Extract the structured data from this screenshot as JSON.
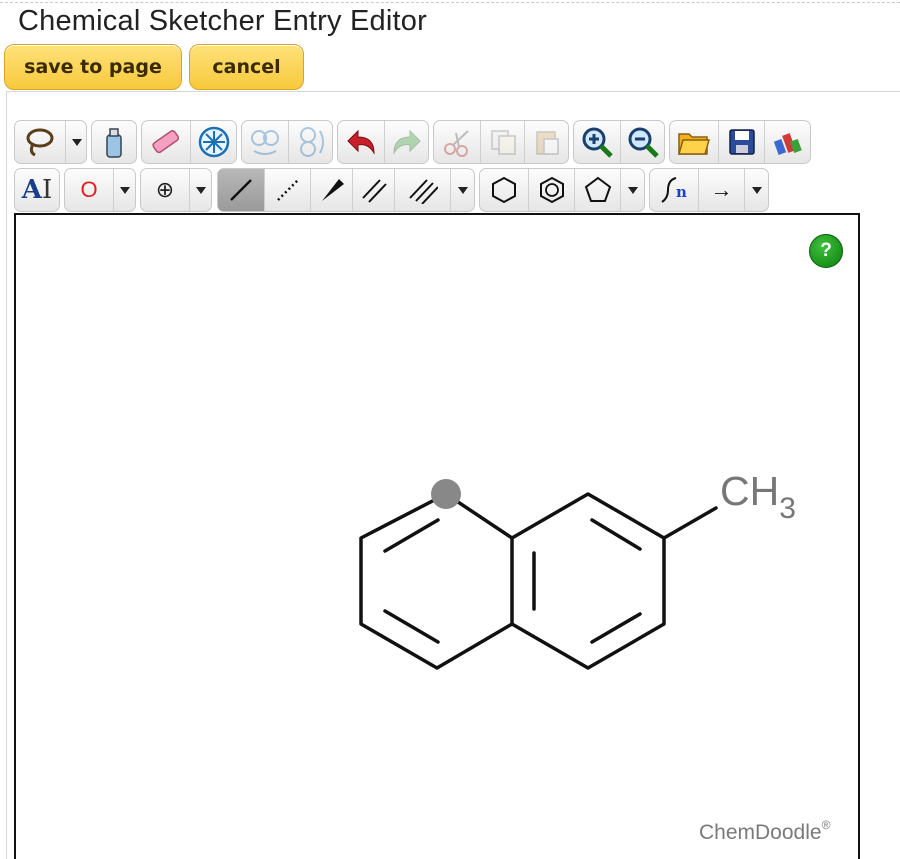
{
  "page": {
    "title": "Chemical Sketcher Entry Editor"
  },
  "actions": {
    "save_label": "save to page",
    "cancel_label": "cancel"
  },
  "toolbar": {
    "row1": [
      "lasso-icon",
      "dropdown-caret",
      "clear-icon",
      "eraser-icon",
      "center-icon",
      "flip-horizontal-icon",
      "flip-vertical-icon",
      "undo-icon",
      "redo-icon",
      "cut-icon",
      "copy-icon",
      "paste-icon",
      "zoom-in-icon",
      "zoom-out-icon",
      "open-icon",
      "save-icon",
      "settings-icon"
    ],
    "row2": {
      "label_tool": "A",
      "atom_label": "O",
      "charge_label": "⊕",
      "bond_types": [
        "single",
        "recessed",
        "protruding",
        "double",
        "triple"
      ],
      "ring_types": [
        "cyclohexane",
        "benzene",
        "cyclopentane"
      ],
      "chain_n": "n",
      "arrow": "→"
    }
  },
  "sketch": {
    "methyl_group": "CH",
    "methyl_subscript": "3",
    "molecule": "2-methylnaphthalene"
  },
  "help": {
    "label": "?"
  },
  "brand": {
    "name": "ChemDoodle",
    "mark": "®"
  },
  "colors": {
    "button": "#f7c93c",
    "help": "#0a8f0a",
    "selected_atom": "#888888"
  }
}
